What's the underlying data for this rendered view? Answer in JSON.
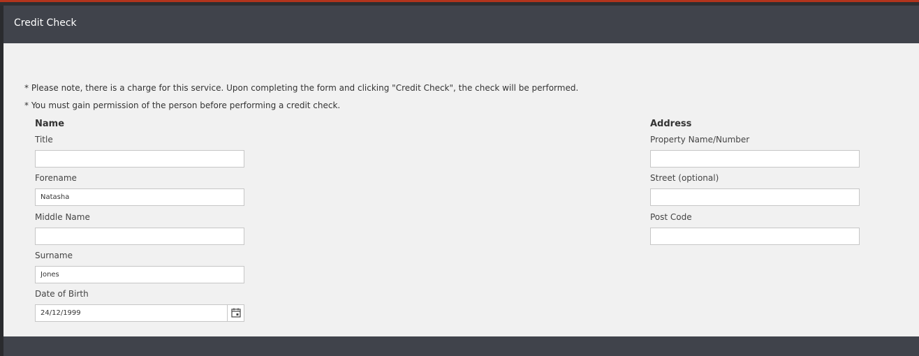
{
  "modal": {
    "title": "Credit Check"
  },
  "notes": [
    "* Please note, there is a charge for this service. Upon completing the form and clicking \"Credit Check\", the check will be performed.",
    "* You must gain permission of the person before performing a credit check."
  ],
  "name_section": {
    "heading": "Name",
    "title": {
      "label": "Title",
      "value": ""
    },
    "forename": {
      "label": "Forename",
      "value": "Natasha"
    },
    "middle_name": {
      "label": "Middle Name",
      "value": ""
    },
    "surname": {
      "label": "Surname",
      "value": "Jones"
    },
    "dob": {
      "label": "Date of Birth",
      "value": "24/12/1999"
    }
  },
  "address_section": {
    "heading": "Address",
    "property": {
      "label": "Property Name/Number",
      "value": ""
    },
    "street": {
      "label": "Street (optional)",
      "value": ""
    },
    "postcode": {
      "label": "Post Code",
      "value": ""
    }
  },
  "icons": {
    "calendar": "calendar-icon"
  },
  "colors": {
    "header_bg": "#40434b",
    "body_bg": "#f1f1f1",
    "accent_strip": "#b2341c"
  }
}
